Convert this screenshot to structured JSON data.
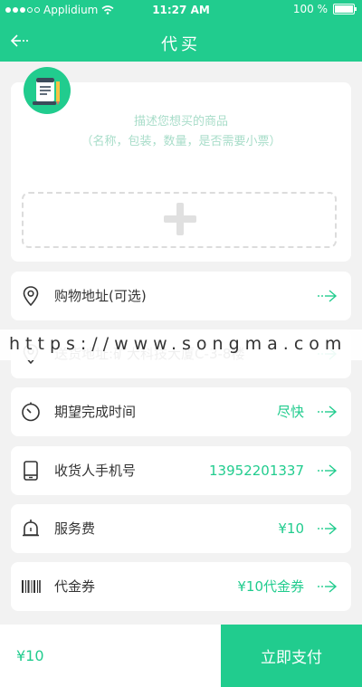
{
  "status_bar": {
    "carrier": "Applidium",
    "time": "11:27 AM",
    "battery": "100 %"
  },
  "header": {
    "title": "代买",
    "back_icon": "back-arrow-icon"
  },
  "goods": {
    "hint_line1": "描述您想买的商品",
    "hint_line2": "（名称，包装，数量，是否需要小票）",
    "add_icon": "plus-icon",
    "badge_icon": "receipt-icon"
  },
  "rows": [
    {
      "label": "购物地址(可选)",
      "value": "",
      "icon": "location-pin-icon"
    },
    {
      "label": "送货地址:矿大科技大厦C-3-8楼",
      "value": "",
      "icon": "location-pin-icon"
    },
    {
      "label": "期望完成时间",
      "value": "尽快",
      "icon": "timer-icon"
    },
    {
      "label": "收货人手机号",
      "value": "13952201337",
      "icon": "phone-icon"
    },
    {
      "label": "服务费",
      "value": "¥10",
      "icon": "bell-icon"
    },
    {
      "label": "代金券",
      "value": "¥10代金券",
      "icon": "barcode-icon"
    }
  ],
  "watermark": "https://www.songma.com",
  "footer": {
    "total": "¥10",
    "pay_label": "立即支付"
  },
  "colors": {
    "accent": "#21cc8e",
    "background": "#f2f2f2"
  }
}
